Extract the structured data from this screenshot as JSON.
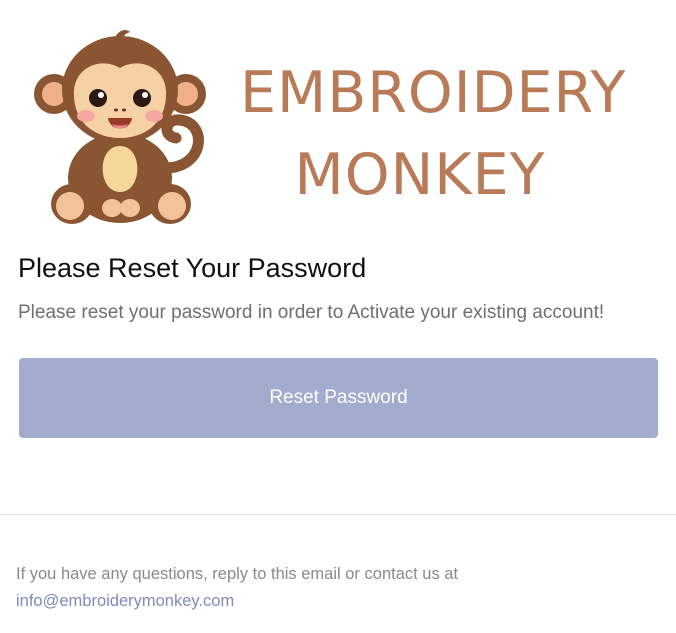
{
  "header": {
    "logo": {
      "text_line1": "EMBROIDERY",
      "text_line2": "MONKEY",
      "mascot_icon": "monkey-mascot-icon"
    }
  },
  "main": {
    "title": "Please Reset Your Password",
    "message": "Please reset your password in order to Activate your existing account!",
    "reset_button_label": "Reset Password"
  },
  "footer": {
    "text": "If you have any questions, reply to this email or contact us at",
    "email": "info@embroiderymonkey.com"
  },
  "colors": {
    "brand_text": "#b87a57",
    "button_bg": "#a3abce",
    "link": "#7d8bbf"
  }
}
